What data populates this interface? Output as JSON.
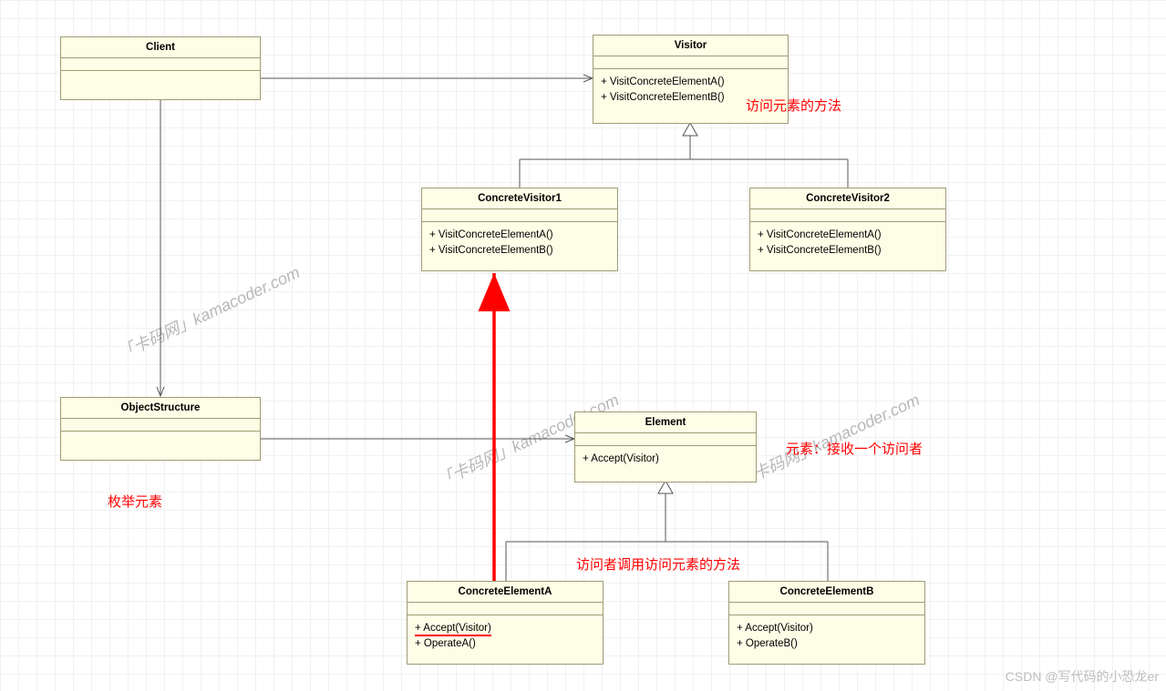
{
  "classes": {
    "client": {
      "name": "Client"
    },
    "visitor": {
      "name": "Visitor",
      "m1": "+ VisitConcreteElementA()",
      "m2": "+ VisitConcreteElementB()"
    },
    "cv1": {
      "name": "ConcreteVisitor1",
      "m1": "+ VisitConcreteElementA()",
      "m2": "+ VisitConcreteElementB()"
    },
    "cv2": {
      "name": "ConcreteVisitor2",
      "m1": "+ VisitConcreteElementA()",
      "m2": "+ VisitConcreteElementB()"
    },
    "object_structure": {
      "name": "ObjectStructure"
    },
    "element": {
      "name": "Element",
      "m1": "+ Accept(Visitor)"
    },
    "cea": {
      "name": "ConcreteElementA",
      "m1": "+ Accept(Visitor)",
      "m2": "+ OperateA()"
    },
    "ceb": {
      "name": "ConcreteElementB",
      "m1": "+ Accept(Visitor)",
      "m2": "+ OperateB()"
    }
  },
  "annotations": {
    "visit_method": "访问元素的方法",
    "enum_elements": "枚举元素",
    "element_accept": "元素：接收一个访问者",
    "visitor_call": "访问者调用访问元素的方法"
  },
  "watermarks": {
    "w1": "「卡码网」kamacoder.com",
    "w2": "「卡码网」kamacoder.com",
    "w3": "「卡码网」kamacoder.com",
    "csdn": "CSDN @写代码的小恐龙er"
  }
}
